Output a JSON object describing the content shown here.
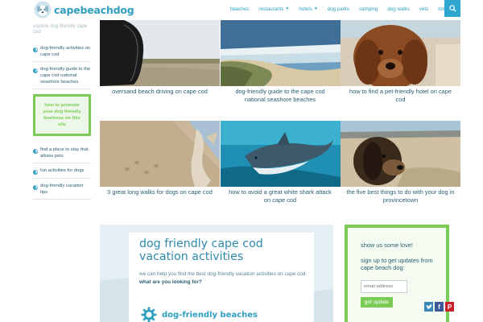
{
  "header": {
    "logo_text": "capebeachdog",
    "nav": [
      {
        "label": "beaches",
        "dropdown": false
      },
      {
        "label": "restaurants",
        "dropdown": true
      },
      {
        "label": "hotels",
        "dropdown": true
      },
      {
        "label": "dog parks",
        "dropdown": false
      },
      {
        "label": "camping",
        "dropdown": false
      },
      {
        "label": "dog walks",
        "dropdown": false
      },
      {
        "label": "vets",
        "dropdown": false
      },
      {
        "label": "towns",
        "dropdown": true
      }
    ],
    "search_icon": "search-icon"
  },
  "sidebar": {
    "explore_label": "explore dog-friendly cape cod",
    "items": [
      {
        "label": "dog-friendly activities on cape cod"
      },
      {
        "label": "dog-friendly guide to the cape cod national seashore beaches"
      },
      {
        "label": "find a place to stay that allows pets"
      },
      {
        "label": "fun activities for dogs"
      },
      {
        "label": "dog-friendly vacation tips"
      }
    ],
    "promo": "how to promote your dog friendly business on this site"
  },
  "cards": [
    {
      "caption": "oversand beach driving on cape cod"
    },
    {
      "caption": "dog-friendly guide to the cape cod national seashore beaches"
    },
    {
      "caption": "how to find a pet-friendly hotel on cape cod"
    },
    {
      "caption": "3 great long walks for dogs on cape cod"
    },
    {
      "caption": "how to avoid a great white shark attack on cape cod"
    },
    {
      "caption": "the five best things to do with your dog in provincetown"
    }
  ],
  "activities": {
    "title": "dog friendly cape cod vacation activities",
    "desc": "we can help you find the best dog-friendly vacation activities on cape cod.",
    "question": "what are you looking for?",
    "item_label": "dog-friendly beaches"
  },
  "signup": {
    "love": "show us some love!",
    "text": "sign up to get updates from cape beach dog:",
    "email_placeholder": "email address",
    "button": "get update"
  },
  "social": {
    "twitter": "twitter-icon",
    "facebook": "facebook-icon",
    "pinterest": "pinterest-icon"
  },
  "colors": {
    "brand_blue": "#2e9fc0",
    "accent_green": "#7acc57",
    "text_dark": "#2a5f72",
    "panel_bg": "#e8f1f5"
  }
}
